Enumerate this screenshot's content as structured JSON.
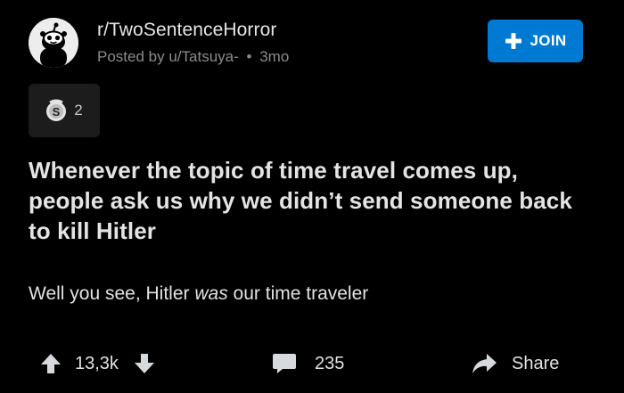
{
  "post": {
    "subreddit": "r/TwoSentenceHorror",
    "posted_by_prefix": "Posted by",
    "author": "u/Tatsuya-",
    "separator": "•",
    "age": "3mo",
    "join_label": "JOIN",
    "award_count": "2",
    "title": "Whenever the topic of time travel comes up, people ask us why we didn’t send someone back to kill Hitler",
    "body": {
      "before": "Well you see, Hitler ",
      "emphasis": "was",
      "after": " our time traveler"
    }
  },
  "actions": {
    "score": "13,3k",
    "comments": "235",
    "share_label": "Share"
  },
  "icons": {
    "avatar": "subreddit-avatar",
    "join": "plus-icon",
    "award": "silver-award-icon",
    "upvote": "upvote-arrow-icon",
    "downvote": "downvote-arrow-icon",
    "comment": "comment-bubble-icon",
    "share": "share-arrow-icon"
  },
  "colors": {
    "background": "#000000",
    "accent": "#0079d3",
    "text_primary": "#e4e4e4",
    "text_muted": "#8b8b8b",
    "chip": "#1c1c1c"
  }
}
